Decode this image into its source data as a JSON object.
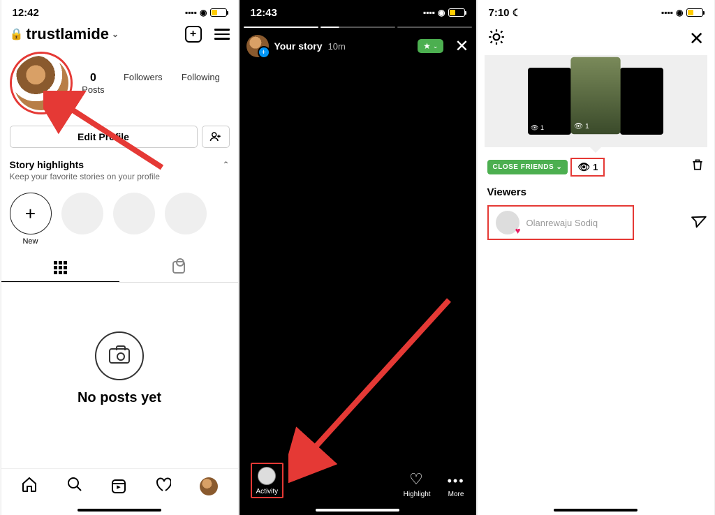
{
  "phone1": {
    "status_time": "12:42",
    "username": "trustlamide",
    "stats": {
      "posts_num": "0",
      "posts": "Posts",
      "followers": "Followers",
      "following": "Following"
    },
    "edit_profile": "Edit Profile",
    "highlights_title": "Story highlights",
    "highlights_sub": "Keep your favorite stories on your profile",
    "new_label": "New",
    "no_posts": "No posts yet"
  },
  "phone2": {
    "status_time": "12:43",
    "your_story": "Your story",
    "story_time": "10m",
    "activity": "Activity",
    "highlight": "Highlight",
    "more": "More"
  },
  "phone3": {
    "status_time": "7:10",
    "close_friends": "CLOSE FRIENDS",
    "view_count": "1",
    "thumb_views": "1",
    "viewers_title": "Viewers",
    "viewer_name": "Olanrewaju Sodiq"
  }
}
